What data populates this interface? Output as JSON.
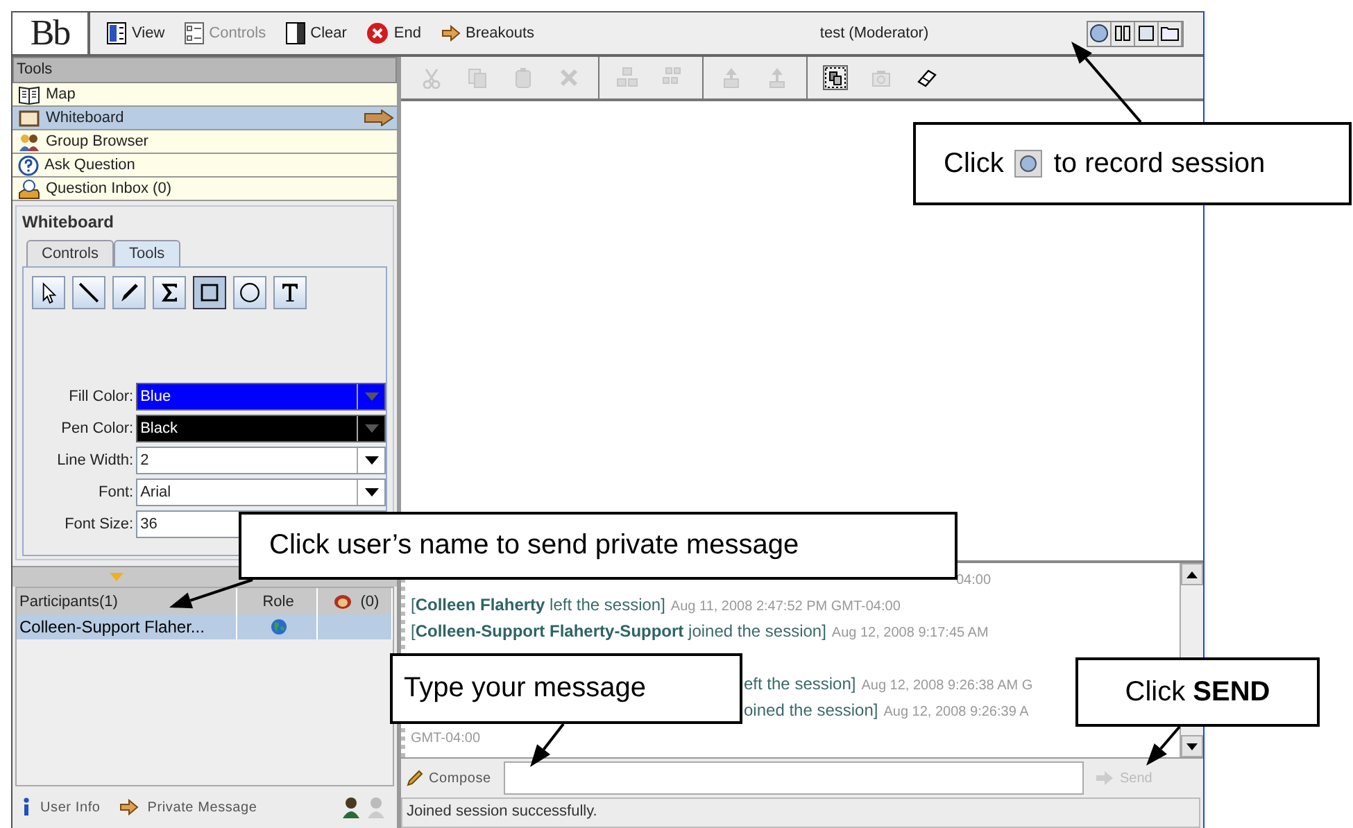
{
  "top_bar": {
    "logo": "Bb",
    "buttons": [
      {
        "kind": "view",
        "label": "View",
        "disabled": false
      },
      {
        "kind": "controls",
        "label": "Controls",
        "disabled": true
      },
      {
        "kind": "clear",
        "label": "Clear",
        "disabled": false
      },
      {
        "kind": "end",
        "label": "End",
        "disabled": false
      },
      {
        "kind": "breakouts",
        "label": "Breakouts",
        "disabled": false
      }
    ],
    "title": "test (Moderator)",
    "session_buttons": [
      {
        "kind": "record"
      },
      {
        "kind": "pause"
      },
      {
        "kind": "stop"
      },
      {
        "kind": "folder"
      }
    ]
  },
  "tools_panel": {
    "title": "Tools",
    "items": [
      {
        "kind": "map",
        "label": "Map",
        "selected": false
      },
      {
        "kind": "whiteboard",
        "label": "Whiteboard",
        "selected": true
      },
      {
        "kind": "group",
        "label": "Group Browser",
        "selected": false
      },
      {
        "kind": "ask",
        "label": "Ask Question",
        "selected": false
      },
      {
        "kind": "inbox",
        "label": "Question Inbox (0)",
        "selected": false
      }
    ]
  },
  "whiteboard_panel": {
    "title": "Whiteboard",
    "tabs": [
      {
        "label": "Controls",
        "selected": false
      },
      {
        "label": "Tools",
        "selected": true
      }
    ],
    "tools": [
      {
        "kind": "pointer",
        "selected": false
      },
      {
        "kind": "line",
        "selected": false
      },
      {
        "kind": "pen",
        "selected": false
      },
      {
        "kind": "sigma",
        "selected": false
      },
      {
        "kind": "rectangle",
        "selected": true
      },
      {
        "kind": "ellipse",
        "selected": false
      },
      {
        "kind": "text",
        "selected": false
      }
    ],
    "fields": [
      {
        "kind": "combo",
        "label": "Fill Color:",
        "value": "Blue",
        "color": "#0000ff"
      },
      {
        "kind": "combo",
        "label": "Pen Color:",
        "value": "Black",
        "color": "#000000"
      },
      {
        "kind": "combo",
        "label": "Line Width:",
        "value": "2"
      },
      {
        "kind": "combo",
        "label": "Font:",
        "value": "Arial"
      },
      {
        "kind": "text",
        "label": "Font Size:",
        "value": "36"
      }
    ]
  },
  "participants": {
    "columns": [
      "Participants(1)",
      "Role",
      "(0)"
    ],
    "rows": [
      {
        "name": "Colleen-Support Flaher...",
        "selected": true
      }
    ],
    "footer": [
      "User Info",
      "Private Message"
    ]
  },
  "edit_toolbar": [
    {
      "kind": "cut",
      "disabled": true,
      "selected": false
    },
    {
      "kind": "copy",
      "disabled": true,
      "selected": false
    },
    {
      "kind": "paste",
      "disabled": true,
      "selected": false
    },
    {
      "kind": "delete",
      "disabled": true,
      "selected": false
    },
    {
      "kind": "group",
      "disabled": true,
      "selected": false
    },
    {
      "kind": "ungroup",
      "disabled": true,
      "selected": false
    },
    {
      "kind": "front",
      "disabled": true,
      "selected": false
    },
    {
      "kind": "back",
      "disabled": true,
      "selected": false
    },
    {
      "kind": "capture",
      "disabled": false,
      "selected": true
    },
    {
      "kind": "camera",
      "disabled": true,
      "selected": false
    },
    {
      "kind": "eraser",
      "disabled": false,
      "selected": false
    }
  ],
  "chat": {
    "lines": [
      {
        "kind": "tail-top",
        "time": "04:00"
      },
      {
        "kind": "full",
        "text": "[**Colleen Flaherty** left the session]",
        "time": "Aug 11, 2008 2:47:52 PM GMT-04:00"
      },
      {
        "kind": "full",
        "text": "[**Colleen-Support Flaherty-Support** joined the session]",
        "time": "Aug 12, 2008 9:17:45 AM"
      },
      {
        "kind": "tail",
        "text": "eft the session]",
        "time": "Aug 12, 2008 9:26:38 AM G"
      },
      {
        "kind": "tail",
        "text": "oined the session]",
        "time": "Aug 12, 2008 9:26:39 A"
      },
      {
        "kind": "wrap",
        "time": "GMT-04:00"
      }
    ]
  },
  "compose": {
    "label": "Compose",
    "send": "Send",
    "send_disabled": true
  },
  "status_bar": "Joined session successfully.",
  "callouts": [
    {
      "kind": "record",
      "text": "Click",
      "text_after": "to record session"
    },
    {
      "kind": "participant",
      "text": "Click user’s name to send private message"
    },
    {
      "kind": "compose",
      "text": "Type your message"
    },
    {
      "kind": "send",
      "text": "Click **SEND**"
    }
  ]
}
